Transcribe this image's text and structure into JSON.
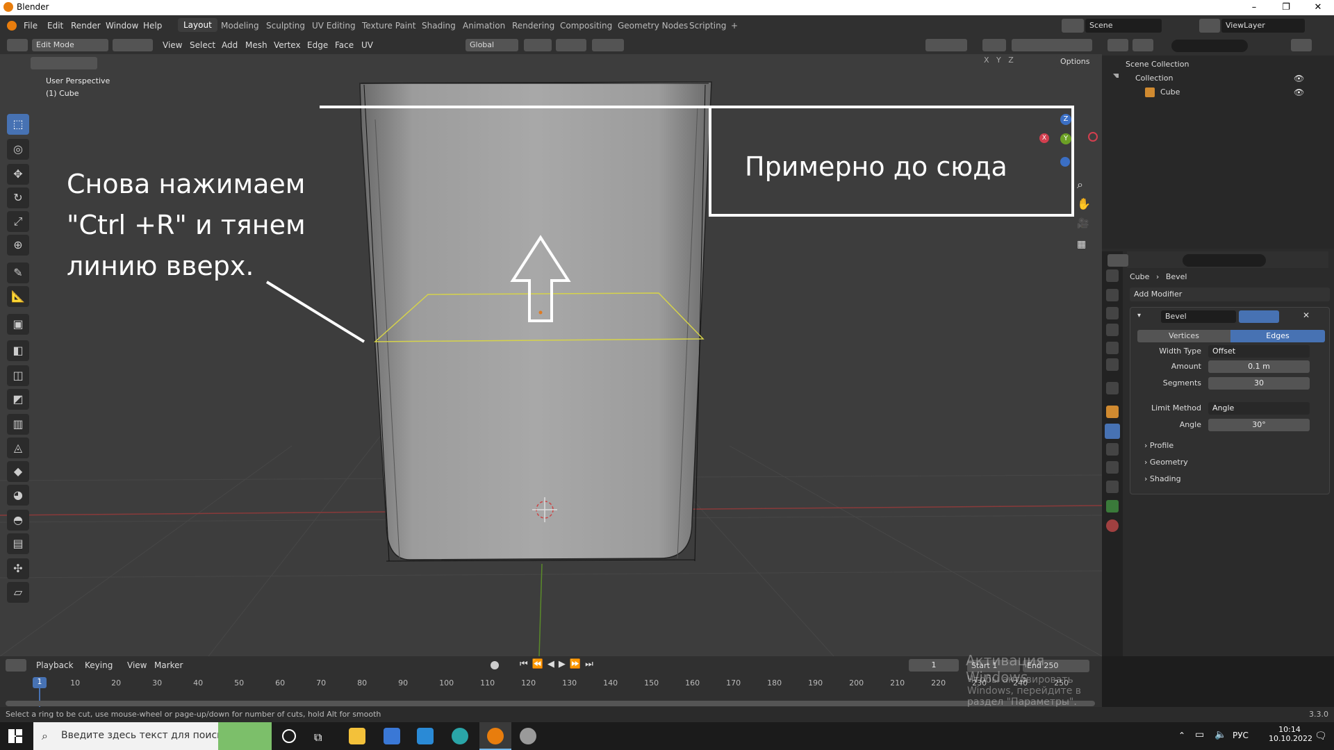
{
  "window": {
    "title": "Blender",
    "controls": [
      "–",
      "❐",
      "✕"
    ]
  },
  "menu": {
    "items": [
      "File",
      "Edit",
      "Render",
      "Window",
      "Help"
    ],
    "workspaces": [
      "Layout",
      "Modeling",
      "Sculpting",
      "UV Editing",
      "Texture Paint",
      "Shading",
      "Animation",
      "Rendering",
      "Compositing",
      "Geometry Nodes",
      "Scripting"
    ],
    "add_tab": "+",
    "scene": "Scene",
    "view_layer": "ViewLayer"
  },
  "viewport": {
    "mode": "Edit Mode",
    "header_menus": [
      "View",
      "Select",
      "Add",
      "Mesh",
      "Vertex",
      "Edge",
      "Face",
      "UV"
    ],
    "transform": "Global",
    "options": "Options",
    "axes": [
      "X",
      "Y",
      "Z"
    ],
    "info_line1": "User Perspective",
    "info_line2": "(1) Cube",
    "annotation_main": [
      "Снова нажимаем",
      "\"Ctrl +R\" и тянем",
      "линию вверх."
    ],
    "annotation_box": "Примерно до сюда",
    "gizmo": {
      "z": "Z",
      "y": "Y",
      "x": "X"
    }
  },
  "outliner": {
    "root": "Scene Collection",
    "collection": "Collection",
    "object": "Cube"
  },
  "properties": {
    "breadcrumb_object": "Cube",
    "breadcrumb_mod": "Bevel",
    "add_modifier": "Add Modifier",
    "modifier_name": "Bevel",
    "tab_vertices": "Vertices",
    "tab_edges": "Edges",
    "width_type_label": "Width Type",
    "width_type": "Offset",
    "amount_label": "Amount",
    "amount": "0.1 m",
    "segments_label": "Segments",
    "segments": "30",
    "limit_label": "Limit Method",
    "limit": "Angle",
    "angle_label": "Angle",
    "angle": "30°",
    "panels": [
      "Profile",
      "Geometry",
      "Shading"
    ]
  },
  "timeline": {
    "menus": [
      "Playback",
      "Keying",
      "View",
      "Marker"
    ],
    "current": "1",
    "start_label": "Start",
    "start": "1",
    "end_label": "End",
    "end": "250",
    "ticks": [
      "1",
      "10",
      "20",
      "30",
      "40",
      "50",
      "60",
      "70",
      "80",
      "90",
      "100",
      "110",
      "120",
      "130",
      "140",
      "150",
      "160",
      "170",
      "180",
      "190",
      "200",
      "210",
      "220",
      "230",
      "240",
      "250"
    ],
    "activation_title": "Активация Windows",
    "activation_sub": "Чтобы активировать Windows, перейдите в раздел \"Параметры\"."
  },
  "status": {
    "hint": "Select a ring to be cut, use mouse-wheel or page-up/down for number of cuts, hold Alt for smooth",
    "version": "3.3.0"
  },
  "taskbar": {
    "search_placeholder": "Введите здесь текст для поиска",
    "lang": "РУС",
    "time": "10:14",
    "date": "10.10.2022"
  }
}
